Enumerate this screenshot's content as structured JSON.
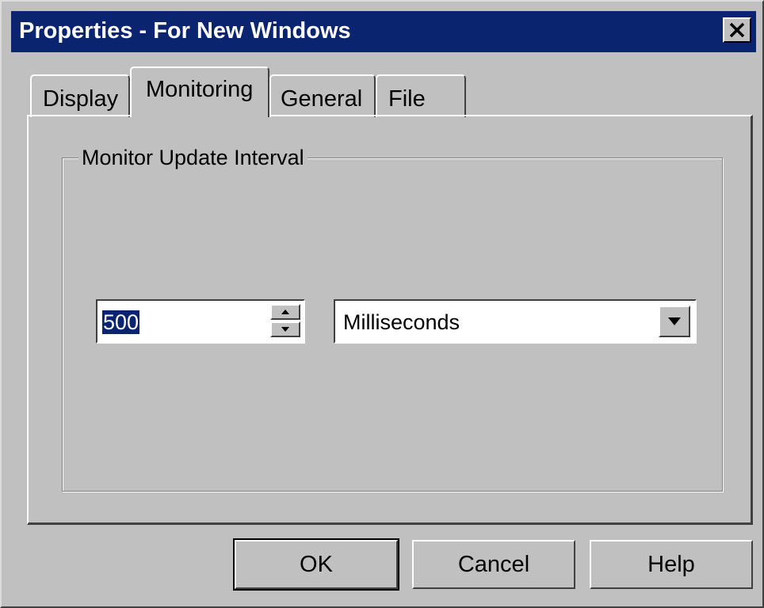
{
  "window": {
    "title": "Properties - For New Windows",
    "close_icon": "close-x-icon"
  },
  "tabs": [
    {
      "label": "Display",
      "active": false
    },
    {
      "label": "Monitoring",
      "active": true
    },
    {
      "label": "General",
      "active": false
    },
    {
      "label": "File",
      "active": false
    }
  ],
  "monitor_group": {
    "label": "Monitor Update Interval",
    "interval_value": "500",
    "unit_selected": "Milliseconds"
  },
  "buttons": {
    "ok": "OK",
    "cancel": "Cancel",
    "help": "Help"
  },
  "colors": {
    "titlebar": "#0a2470",
    "face": "#c0c0c0"
  }
}
